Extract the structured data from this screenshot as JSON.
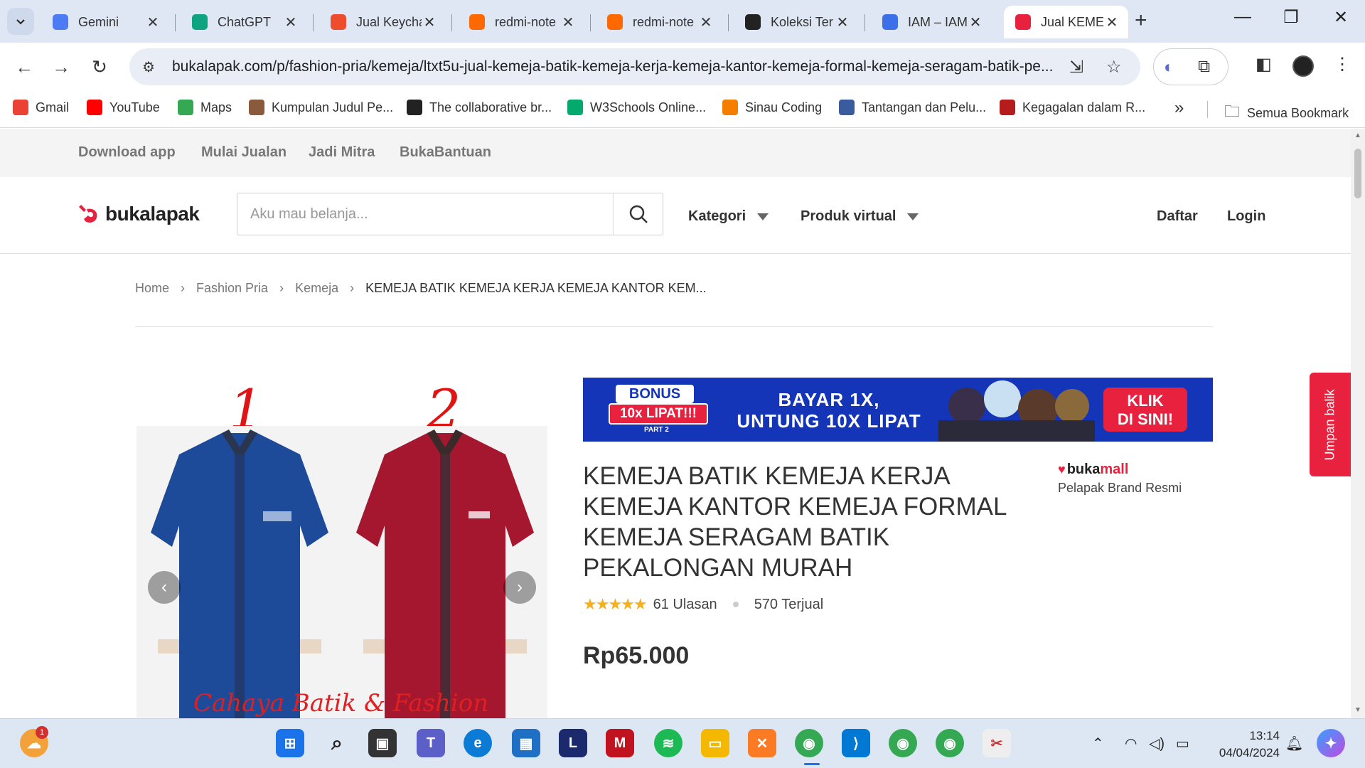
{
  "browser": {
    "tabs": [
      {
        "label": "Gemini",
        "icon": "gemini-icon",
        "color": "#4c7bf3"
      },
      {
        "label": "ChatGPT",
        "icon": "chatgpt-icon",
        "color": "#10a37f"
      },
      {
        "label": "Jual Keychain",
        "icon": "shopee-icon",
        "color": "#ee4d2d"
      },
      {
        "label": "redmi-note",
        "icon": "mi-icon",
        "color": "#ff6900"
      },
      {
        "label": "redmi-note",
        "icon": "mi-icon",
        "color": "#ff6900"
      },
      {
        "label": "Koleksi Ter",
        "icon": "infinity-icon",
        "color": "#222222"
      },
      {
        "label": "IAM – IAM",
        "icon": "shield-icon",
        "color": "#3d6fe8"
      },
      {
        "label": "Jual KEMEJA",
        "icon": "bukalapak-icon",
        "color": "#e8213f"
      }
    ],
    "new_tab": "+",
    "url": "bukalapak.com/p/fashion-pria/kemeja/ltxt5u-jual-kemeja-batik-kemeja-kerja-kemeja-kantor-kemeja-formal-kemeja-seragam-batik-pe...",
    "bookmarks": [
      {
        "label": "Gmail",
        "icon": "gmail-icon",
        "color": "#ea4335"
      },
      {
        "label": "YouTube",
        "icon": "youtube-icon",
        "color": "#ff0000"
      },
      {
        "label": "Maps",
        "icon": "maps-icon",
        "color": "#34a853"
      },
      {
        "label": "Kumpulan Judul Pe...",
        "icon": "person-icon",
        "color": "#8a5a3c"
      },
      {
        "label": "The collaborative br...",
        "icon": "circle-logo-icon",
        "color": "#222222"
      },
      {
        "label": "W3Schools Online...",
        "icon": "w3schools-icon",
        "color": "#04aa6d"
      },
      {
        "label": "Sinau Coding",
        "icon": "blogger-icon",
        "color": "#f57d00"
      },
      {
        "label": "Tantangan dan Pelu...",
        "icon": "book-icon",
        "color": "#3a5c9e"
      },
      {
        "label": "Kegagalan dalam R...",
        "icon": "badge-icon",
        "color": "#b71c1c"
      }
    ],
    "all_bookmarks": "Semua Bookmark"
  },
  "site": {
    "top_links": [
      "Download app",
      "Mulai Jualan",
      "Jadi Mitra",
      "BukaBantuan"
    ],
    "logo_text": "bukalapak",
    "search_placeholder": "Aku mau belanja...",
    "menu": {
      "kategori": "Kategori",
      "produk_virtual": "Produk virtual"
    },
    "auth": {
      "daftar": "Daftar",
      "login": "Login"
    },
    "brand_color": "#e8213f"
  },
  "breadcrumb": [
    "Home",
    "Fashion Pria",
    "Kemeja",
    "KEMEJA BATIK KEMEJA KERJA KEMEJA KANTOR KEM..."
  ],
  "gallery": {
    "labels": [
      "1",
      "2"
    ],
    "watermark": "Cahaya Batik & Fashion"
  },
  "banner": {
    "bonus": "BONUS",
    "bonus_sub": "10x LIPAT!!!",
    "part": "PART 2",
    "headline_1": "BAYAR 1X,",
    "headline_2": "UNTUNG 10X LIPAT",
    "cta_1": "KLIK",
    "cta_2": "DI SINI!"
  },
  "product": {
    "title": "KEMEJA BATIK KEMEJA KERJA KEMEJA KANTOR KEMEJA FORMAL KEMEJA SERAGAM BATIK PEKALONGAN MURAH",
    "rating": 4.5,
    "reviews": "61 Ulasan",
    "sold": "570 Terjual",
    "price": "Rp65.000",
    "seller_badge_1": "buka",
    "seller_badge_2": "mall",
    "seller_sub": "Pelapak Brand Resmi"
  },
  "feedback": "Umpan balik",
  "taskbar": {
    "notification_count": "1",
    "time": "13:14",
    "date": "04/04/2024"
  }
}
